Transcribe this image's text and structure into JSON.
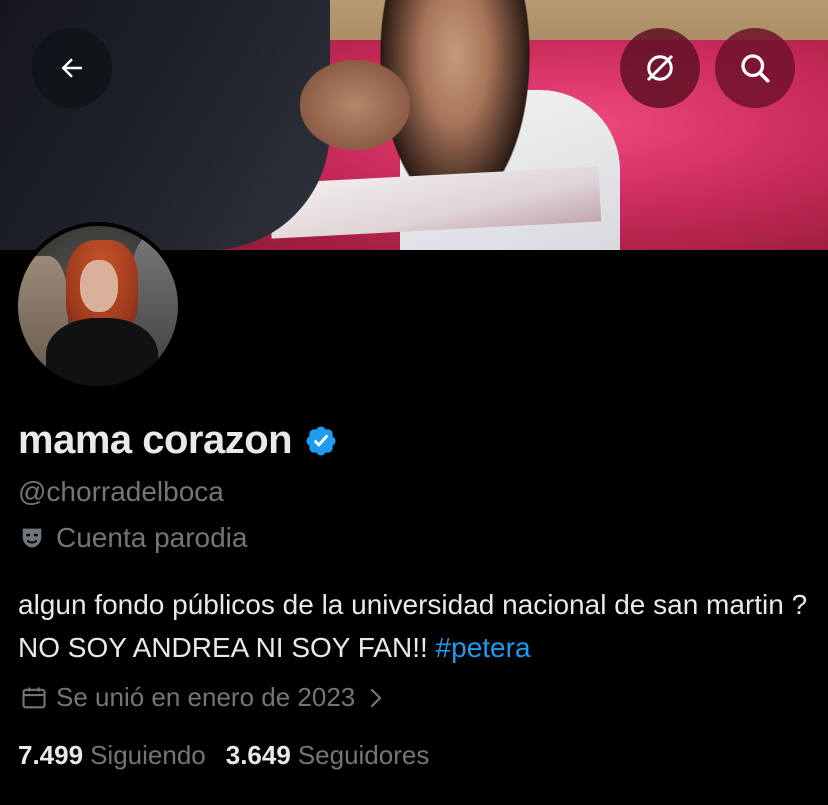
{
  "header": {
    "back_icon": "arrow-left-icon",
    "translate_icon": "globe-slash-icon",
    "search_icon": "search-icon"
  },
  "profile": {
    "display_name": "mama corazon",
    "verified": true,
    "handle": "@chorradelboca",
    "parody_label": "Cuenta parodia",
    "bio_text": "algun fondo públicos de la universidad nacional de san martin ? NO SOY ANDREA NI SOY FAN!! ",
    "bio_hashtag": "#petera",
    "joined": "Se unió en enero de 2023",
    "following_count": "7.499",
    "following_label": "Siguiendo",
    "followers_count": "3.649",
    "followers_label": "Seguidores"
  },
  "colors": {
    "background": "#000000",
    "text_primary": "#e7e9ea",
    "text_secondary": "#71767b",
    "accent": "#1d9bf0"
  }
}
